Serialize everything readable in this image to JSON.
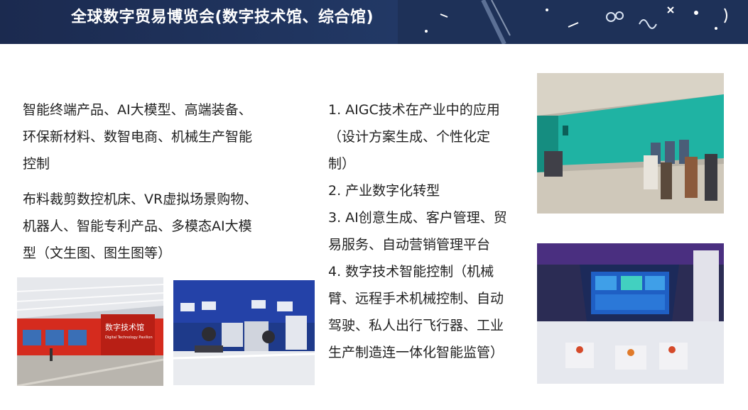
{
  "banner": {
    "title": "全球数字贸易博览会(数字技术馆、综合馆)"
  },
  "left_column": {
    "lines": [
      "智能终端产品、AI大模型、高端装备、",
      "环保新材料、数智电商、机械生产智能",
      "控制",
      "布料裁剪数控机床、VR虚拟场景购物、",
      "机器人、智能专利产品、多模态AI大模",
      "型（文生图、图生图等）"
    ]
  },
  "middle_column": {
    "lines": [
      "1. AIGC技术在产业中的应用",
      "（设计方案生成、个性化定",
      "制）",
      "2. 产业数字化转型",
      "3. AI创意生成、客户管理、贸",
      "易服务、自动营销管理平台",
      "4. 数字技术智能控制（机械",
      "臂、远程手术机械控制、自动",
      "驾驶、私人出行飞行器、工业",
      "生产制造连一体化智能监管）"
    ]
  },
  "photos": {
    "pavilion_sign_text": "数字技术馆",
    "pavilion_sign_sub": "Digital Technology Pavilion"
  },
  "colors": {
    "banner": "#1b2a4f",
    "text": "#222222",
    "pavilion_red": "#d52b1e",
    "hall_teal": "#1fb3a3"
  }
}
